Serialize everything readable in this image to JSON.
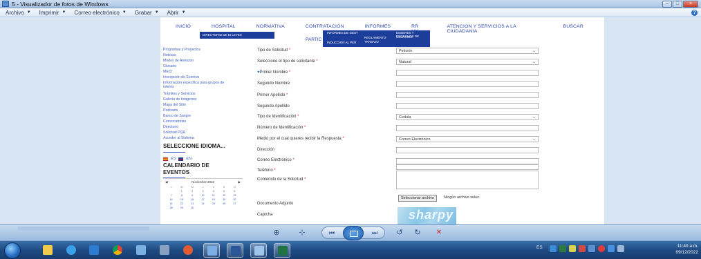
{
  "window": {
    "title": "5 - Visualizador de fotos de Windows",
    "controls": [
      "–",
      "□",
      "×"
    ]
  },
  "menubar": {
    "items": [
      "Archivo",
      "Imprimir",
      "Correo electrónico",
      "Grabar",
      "Abrir"
    ],
    "help": "?"
  },
  "site": {
    "nav": [
      "INICIO",
      "HOSPITAL",
      "NORMATIVA",
      "CONTRATACIÓN",
      "INFORMES",
      "RR HH",
      "ATENCION Y SERVICIOS A LA CIUDADANIA",
      "BUSCAR"
    ],
    "dropdown1": "DIRECTORIO DE EI   LEYES",
    "dropdown2": {
      "a": "INFORMES DE GEST",
      "b": "REGLAMENTO",
      "c": "TRABAJO",
      "d": "DEBERES Y DERECHOS DE",
      "e": "USUARIOS",
      "f": "INDUCCION AL PER"
    },
    "partic": "PARTIC",
    "sidebar_links": [
      "Programas y Proyectos",
      "Noticias",
      "Modos de Atención",
      "Glosario",
      "MECI",
      "Inscripción de Eventos",
      "Información específica para grupos de interés",
      "Trámites y Servicios",
      "Galería de Imágenes",
      "Mapa del Sitio",
      "Podcasts",
      "Banco de Sangre",
      "Convocatorias",
      "Directorio",
      "Solicitud PQR",
      "Acceder al Sistema"
    ],
    "language_heading": "SELECCIONE IDIOMA...",
    "lang_es": "ES",
    "lang_en": "EN",
    "calendar_heading_1": "CALENDARIO DE",
    "calendar_heading_2": "EVENTOS",
    "calendar": {
      "month": "Noviembre 2022",
      "prev": "◀",
      "next": "▶",
      "days": [
        "L",
        "M",
        "M",
        "J",
        "V",
        "S",
        "D"
      ],
      "cells": [
        "",
        "1",
        "2",
        "3",
        "4",
        "5",
        "6",
        "7",
        "8",
        "9",
        "10",
        "11",
        "12",
        "13",
        "14",
        "15",
        "16",
        "17",
        "18",
        "19",
        "20",
        "21",
        "22",
        "23",
        "24",
        "25",
        "26",
        "27",
        "28",
        "29",
        "30",
        "",
        "",
        "",
        ""
      ]
    },
    "form": {
      "tipo_solicitud": "Tipo de Solicitud",
      "tipo_solicitud_val": "Petición",
      "tipo_solicitante": "Seleccione el tipo de solicitante",
      "tipo_solicitante_val": "Natural",
      "primer_nombre": "Primer Nombre",
      "segundo_nombre": "Segundo Nombre",
      "primer_apellido": "Primer Apellido",
      "segundo_apellido": "Segundo Apellido",
      "tipo_id": "Tipo de Identificación",
      "tipo_id_val": "Cedula",
      "numero_id": "Número de Identificación",
      "medio": "Medio por el cual quieres recibir la Respuesta",
      "medio_val": "Correo Electrónico",
      "direccion": "Dirección",
      "correo": "Correo Electrónico",
      "telefono": "Teléfono",
      "contenido": "Contenido de la Solicitud",
      "documento": "Documento Adjunto",
      "file_button": "Seleccionar archivo",
      "file_status": "Ningún archivo selec.",
      "captcha_label": "Captcha",
      "captcha_text": "sharpy",
      "required_mark": "*"
    }
  },
  "viewer_toolbar": {
    "zoom": "⊕",
    "actual_size": "⊹",
    "prev": "⏮",
    "next": "⏭",
    "rotate_ccw": "↺",
    "rotate_cw": "↻",
    "delete": "✕"
  },
  "taskbar": {
    "lang": "ES",
    "time": "11:40 a.m.",
    "date": "09/12/2022"
  }
}
